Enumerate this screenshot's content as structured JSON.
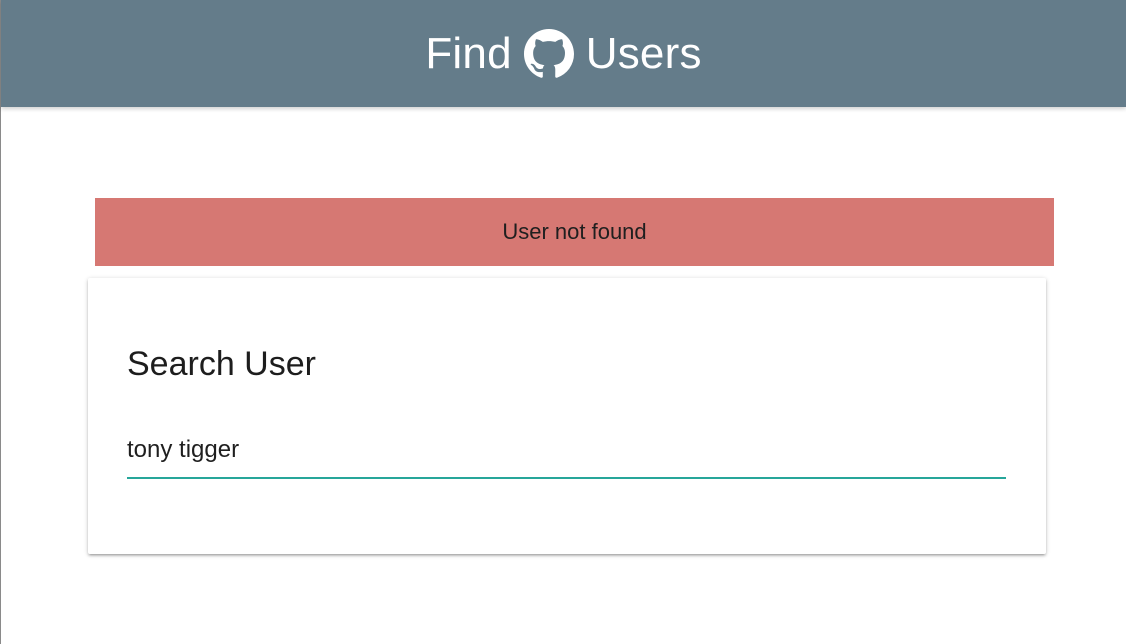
{
  "navbar": {
    "title_before": "Find",
    "logo_icon": "github-octocat-icon",
    "title_after": "Users",
    "background_color": "#647c8a"
  },
  "alert": {
    "message": "User not found",
    "background_color": "#d67873"
  },
  "search_card": {
    "title": "Search User",
    "input_value": "tony tigger",
    "underline_color": "#26a69a"
  }
}
